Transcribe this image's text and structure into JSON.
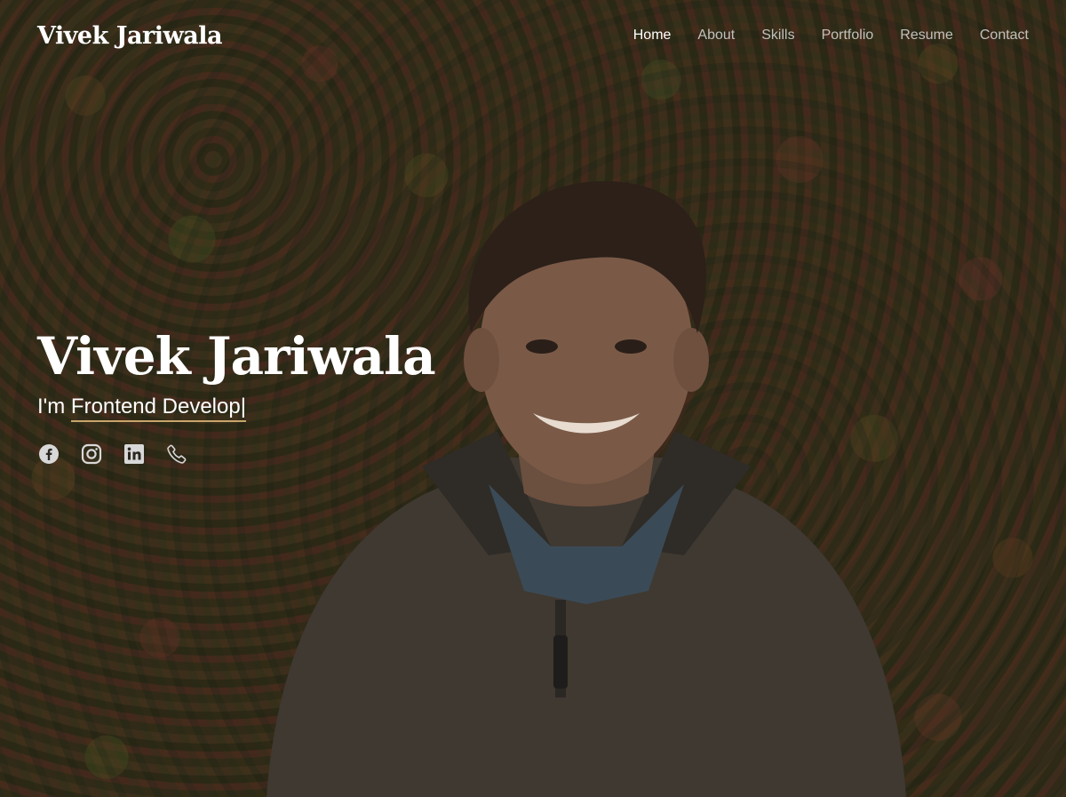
{
  "brand": {
    "name": "Vivek Jariwala"
  },
  "nav": {
    "items": [
      {
        "label": "Home",
        "active": true
      },
      {
        "label": "About",
        "active": false
      },
      {
        "label": "Skills",
        "active": false
      },
      {
        "label": "Portfolio",
        "active": false
      },
      {
        "label": "Resume",
        "active": false
      },
      {
        "label": "Contact",
        "active": false
      }
    ]
  },
  "hero": {
    "title": "Vivek Jariwala",
    "prefix": "I'm ",
    "typed": "Frontend Develop",
    "cursor": "|",
    "socials": [
      "facebook-icon",
      "instagram-icon",
      "linkedin-icon",
      "phone-icon"
    ]
  },
  "colors": {
    "text": "#ffffff",
    "nav_inactive": "rgba(255,255,255,0.7)",
    "typed_underline": "#c9a56b",
    "icon": "#d8d8d8"
  }
}
